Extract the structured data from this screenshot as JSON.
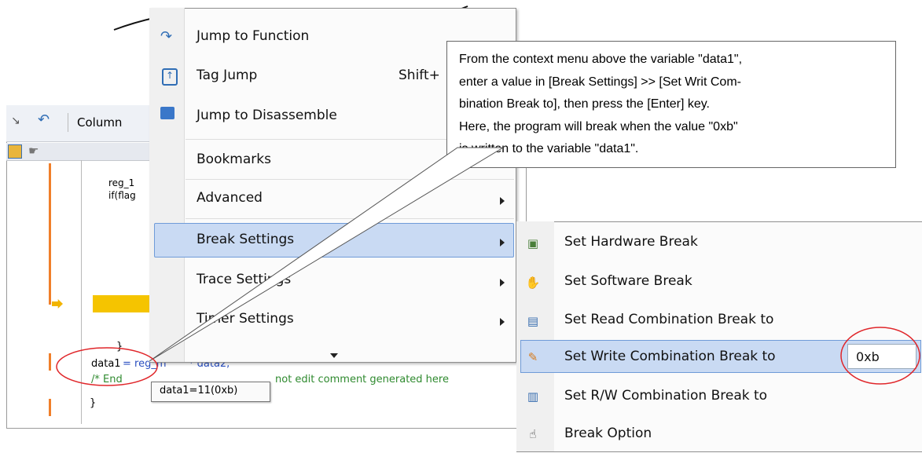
{
  "editor": {
    "toolbar_label": "Column",
    "lines": {
      "reg": "reg_1",
      "if": "if(flag",
      "brace_close": "}",
      "data_line_a": "data1",
      "data_line_b": "= reg_m",
      "data_line_c": "* data2;",
      "comment": "/* End",
      "comment_tail": "not edit comment generated here",
      "last_brace": "}"
    },
    "tooltip": "data1=11(0xb)"
  },
  "context_menu": {
    "items": [
      {
        "label": "Jump to Function"
      },
      {
        "label": "Tag Jump",
        "shortcut": "Shift+"
      },
      {
        "label": "Jump to Disassemble"
      },
      {
        "label": "Bookmarks"
      },
      {
        "label": "Advanced"
      },
      {
        "label": "Break Settings"
      },
      {
        "label": "Trace Settings"
      },
      {
        "label": "Timer Settings"
      }
    ]
  },
  "submenu": {
    "items": [
      {
        "label": "Set Hardware Break"
      },
      {
        "label": "Set Software Break"
      },
      {
        "label": "Set Read Combination Break to"
      },
      {
        "label": "Set Write Combination Break to",
        "value": "0xb"
      },
      {
        "label": "Set R/W Combination Break to"
      },
      {
        "label": "Break Option"
      }
    ]
  },
  "callout": {
    "lines": [
      "From the context menu above the variable \"data1\",",
      "enter a value in [Break Settings] >> [Set Writ Com-",
      "bination Break to], then press the [Enter] key.",
      "Here, the program will break when the value \"0xb\"",
      "is written to the variable \"data1\"."
    ]
  },
  "colors": {
    "highlight": "#c9daf3",
    "highlight_border": "#6f9bd8",
    "annotation": "#e0262a",
    "current_line": "#f5c400",
    "gutter_mark": "#f07f2a"
  }
}
